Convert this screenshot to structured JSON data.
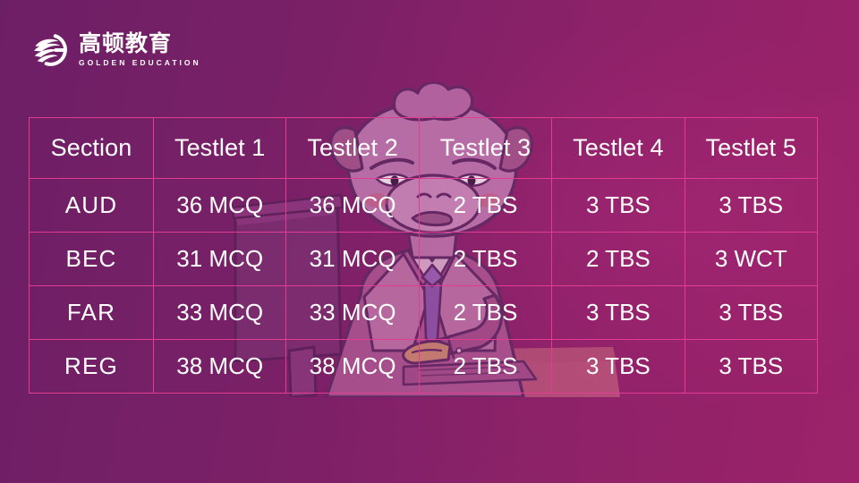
{
  "brand": {
    "logo_mark": "swoosh-circle-icon",
    "name_cn": "高顿教育",
    "name_en": "GOLDEN EDUCATION"
  },
  "colors": {
    "background_left": "#6d1f66",
    "background_right": "#9c2369",
    "grid_line": "#e13b92",
    "text": "#ffffff"
  },
  "illustration": {
    "name": "cartoon-bull-office-worker",
    "description": "cartoon bull character in suit and tie sitting at desk behind a computer monitor"
  },
  "table": {
    "headers": [
      "Section",
      "Testlet 1",
      "Testlet 2",
      "Testlet 3",
      "Testlet 4",
      "Testlet 5"
    ],
    "rows": [
      {
        "section": "AUD",
        "cells": [
          "36 MCQ",
          "36 MCQ",
          "2 TBS",
          "3 TBS",
          "3 TBS"
        ]
      },
      {
        "section": "BEC",
        "cells": [
          "31 MCQ",
          "31 MCQ",
          "2 TBS",
          "2 TBS",
          "3 WCT"
        ]
      },
      {
        "section": "FAR",
        "cells": [
          "33 MCQ",
          "33 MCQ",
          "2 TBS",
          "3 TBS",
          "3 TBS"
        ]
      },
      {
        "section": "REG",
        "cells": [
          "38 MCQ",
          "38 MCQ",
          "2 TBS",
          "3 TBS",
          "3 TBS"
        ]
      }
    ]
  }
}
